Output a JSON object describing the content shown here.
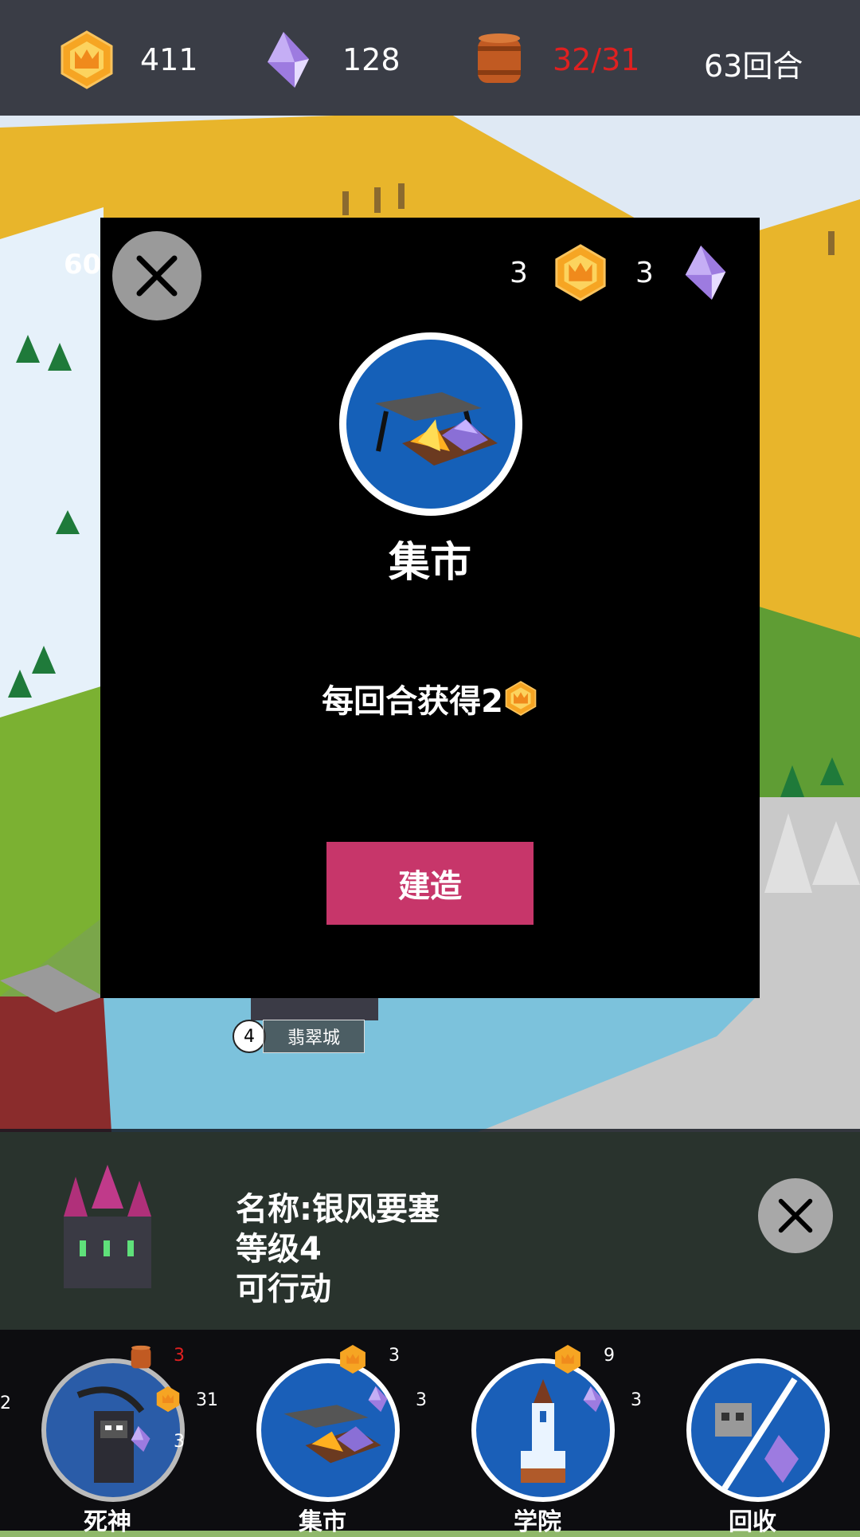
{
  "top_bar": {
    "gold": "411",
    "gems": "128",
    "population": "32/31",
    "turns": "63回合"
  },
  "map": {
    "city_name": "翡翠城",
    "city_level": "4",
    "floating_number": "60"
  },
  "build_modal": {
    "cost_gold": "3",
    "cost_gems": "3",
    "building_name": "集市",
    "description": "每回合获得2",
    "build_button": "建造"
  },
  "selected_unit": {
    "name_line": "名称:银风要塞",
    "level_line": "等级4",
    "status_line": "可行动"
  },
  "action_bar": [
    {
      "label": "死神",
      "icon": "reaper-icon",
      "pop_cost": "3",
      "gold_cost": "31",
      "gem_cost": "3",
      "edge_value": "2"
    },
    {
      "label": "集市",
      "icon": "market-icon",
      "gold_cost": "3",
      "gem_cost": "3"
    },
    {
      "label": "学院",
      "icon": "academy-icon",
      "gold_cost": "9",
      "gem_cost": "3"
    },
    {
      "label": "回收",
      "icon": "recycle-icon"
    }
  ],
  "colors": {
    "build_button": "#c7366a",
    "population_over": "#e02020",
    "pop_cost_red": "#e02020",
    "circle_blue": "#1a5fb8"
  }
}
